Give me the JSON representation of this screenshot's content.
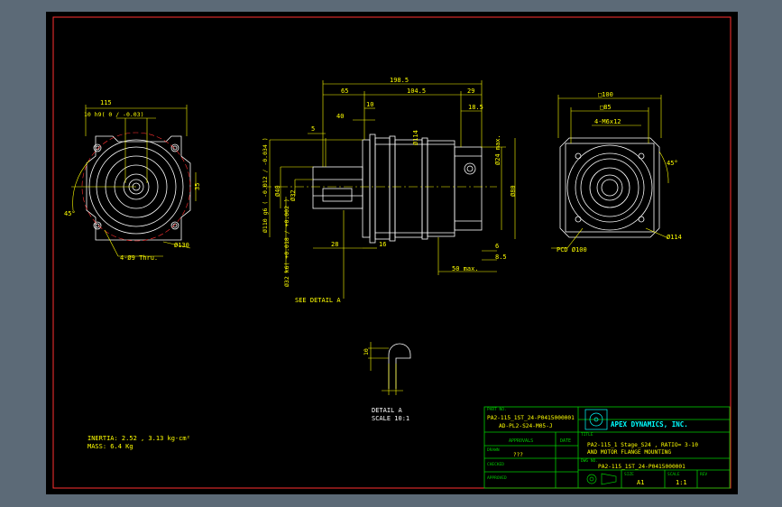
{
  "colors": {
    "background": "#5c6a77",
    "sheet": "#000000",
    "border": "#ff3030",
    "geometry": "#ffffff",
    "dimension": "#ffff00",
    "titleblock": "#00cc00",
    "bolt_circle": "#ff3030",
    "company": "#00ffff"
  },
  "left_view": {
    "dim_width": "115",
    "dim_pilot": "10 h9( 0 / -0.03)",
    "dim_height": "35",
    "angle": "45°",
    "bolt_dia": "Ø130",
    "holes": "4-Ø9 Thru."
  },
  "side_view": {
    "overall": "198.5",
    "seg_65": "65",
    "seg_104": "104.5",
    "seg_29": "29",
    "dim_10": "10",
    "dim_40": "40",
    "dim_5": "5",
    "dim_18_5": "18.5",
    "d114": "Ø114",
    "d24max": "Ø24 max.",
    "d110": "Ø110 g6 ( -0.012 / -0.034 )",
    "d40": "Ø40",
    "d32": "Ø32",
    "d32k6": "Ø32 k6( +0.018 / +0.002 )",
    "d80": "Ø80",
    "dim_28": "28",
    "dim_16": "16",
    "dim_6": "6",
    "dim_8_5": "8.5",
    "max50": "50 max.",
    "see_detail": "SEE DETAIL A"
  },
  "right_view": {
    "sq100": "□100",
    "sq85": "□85",
    "holes": "4-M6x12",
    "angle": "45°",
    "d114": "Ø114",
    "pcd": "PCD Ø100"
  },
  "detail": {
    "dim": "10",
    "label": "DETAIL A",
    "scale": "SCALE 10:1"
  },
  "notes": {
    "inertia": "INERTIA: 2.52 , 3.13 kg-cm²",
    "mass": "MASS: 6.4   Kg"
  },
  "title_block": {
    "part_no_label": "PART NO.",
    "part_no_1": "PA2-115_1ST_24-P0415000001",
    "part_no_2": "AD-PL2-S24-M05-J",
    "company": "APEX DYNAMICS, INC.",
    "approvals": "APPROVALS",
    "date": "DATE",
    "drawn": "DRAWN",
    "drawn_val": "???",
    "checked": "CHECKED",
    "approved": "APPROVED",
    "title_label": "TITLE",
    "title_1": "PA2-115_1 Stage_S24 , RATIO= 3-10",
    "title_2": "AND MOTOR FLANGE MOUNTING",
    "dwg_no_label": "DWG NO.",
    "dwg_no": "PA2-115_1ST_24-P0415000001",
    "size_label": "SIZE",
    "size": "A1",
    "scale_label": "SCALE",
    "scale": "1:1",
    "rev_label": "REV"
  }
}
